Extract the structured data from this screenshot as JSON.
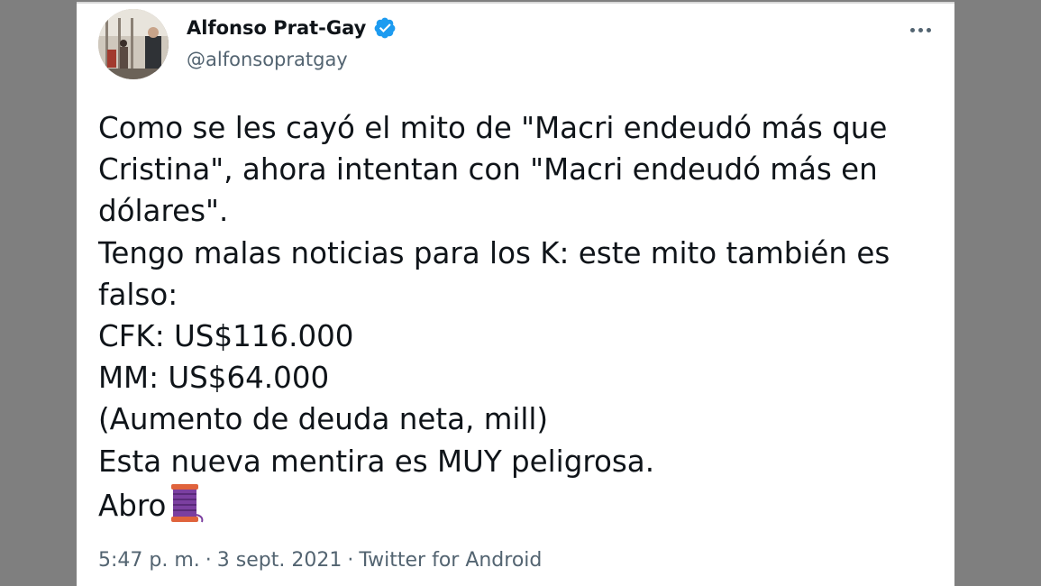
{
  "author": {
    "display_name": "Alfonso Prat-Gay",
    "handle": "@alfonsopratgay",
    "verified": true
  },
  "tweet": {
    "lines": [
      "Como se les cayó el mito de \"Macri endeudó más que",
      "Cristina\", ahora intentan con \"Macri endeudó más en",
      "dólares\".",
      "Tengo malas noticias para los K: este mito también es",
      "falso:",
      "CFK: US$116.000",
      "MM: US$64.000",
      "(Aumento de deuda neta, mill)",
      "Esta nueva mentira es MUY peligrosa.",
      "Abro"
    ],
    "thread_icon": "spool-of-thread-icon"
  },
  "meta": {
    "time": "5:47 p. m.",
    "separator": "·",
    "date": "3 sept. 2021",
    "source": "Twitter for Android"
  },
  "colors": {
    "background": "#7f7f7f",
    "card": "#ffffff",
    "text": "#0f1419",
    "secondary": "#536471",
    "verified": "#1d9bf0"
  }
}
